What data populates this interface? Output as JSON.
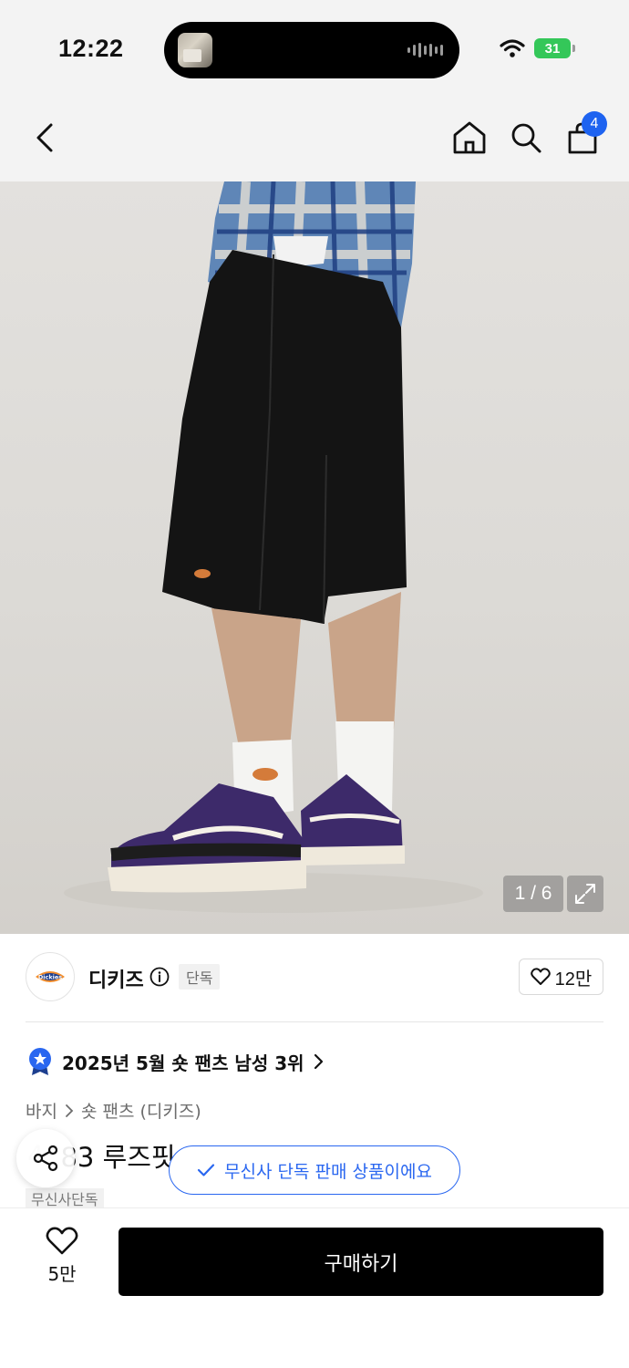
{
  "status_bar": {
    "time": "12:22",
    "battery": "31",
    "icons": [
      "wifi-icon",
      "battery-icon",
      "audio-wave-icon"
    ]
  },
  "header": {
    "icons": [
      "chevron-left-icon",
      "home-icon",
      "search-icon",
      "shopping-bag-icon"
    ],
    "cart_count": "4"
  },
  "gallery": {
    "counter": "1 / 6",
    "expand_icon": "expand-icon"
  },
  "brand": {
    "name": "디키즈",
    "tag": "단독",
    "likes": "12만",
    "logo_text": "Dickies"
  },
  "ranking": {
    "text": "2025년 5월 숏 팬츠 남성 3위",
    "icon": "rank-medal-icon"
  },
  "breadcrumb": {
    "category": "바지",
    "subcategory": "숏 팬츠 (디키즈)"
  },
  "product": {
    "title_hidden_prefix": "4",
    "title_visible": "83 루즈핏",
    "badge": "무신사단독"
  },
  "toast": {
    "message": "무신사 단독 판매 상품이에요"
  },
  "bottom_bar": {
    "wish_count": "5만",
    "buy_label": "구매하기"
  },
  "colors": {
    "accent_blue": "#1e63f0",
    "buy_button": "#000000",
    "battery_green": "#34c759"
  }
}
